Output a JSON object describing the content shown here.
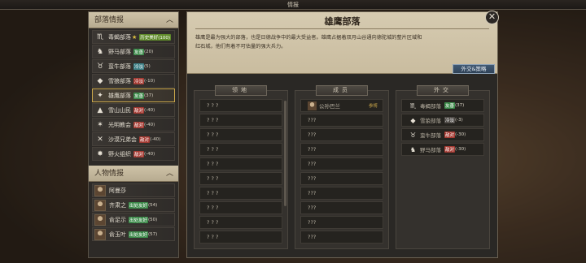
{
  "topbar": {
    "title": "情报"
  },
  "tribes_section": {
    "title": "部落情报",
    "items": [
      {
        "name": "毒蝎部落",
        "star": "★",
        "rel_label": "历史美好(100)",
        "rel_color": "olive",
        "value": "",
        "icon": "scorpion-icon"
      },
      {
        "name": "野马部落",
        "star": "",
        "rel_label": "友善",
        "rel_color": "green",
        "value": "(20)",
        "icon": "horse-icon"
      },
      {
        "name": "蛮牛部落",
        "star": "",
        "rel_label": "冷淡",
        "rel_color": "teal",
        "value": "(5)",
        "icon": "bull-icon"
      },
      {
        "name": "雪狼部落",
        "star": "",
        "rel_label": "冷淡",
        "rel_color": "red",
        "value": "(-10)",
        "icon": "wolf-icon"
      },
      {
        "name": "雄鹰部落",
        "star": "",
        "rel_label": "友善",
        "rel_color": "green",
        "value": "(37)",
        "icon": "eagle-icon"
      },
      {
        "name": "雪山山民",
        "star": "",
        "rel_label": "敌对",
        "rel_color": "red",
        "value": "(-40)",
        "icon": "mountain-icon"
      },
      {
        "name": "光明教会",
        "star": "",
        "rel_label": "敌对",
        "rel_color": "red",
        "value": "(-40)",
        "icon": "church-icon"
      },
      {
        "name": "沙漠兄弟会",
        "star": "",
        "rel_label": "敌对",
        "rel_color": "red",
        "value": "(-40)",
        "icon": "blades-icon"
      },
      {
        "name": "野火组织",
        "star": "",
        "rel_label": "敌对",
        "rel_color": "red",
        "value": "(-40)",
        "icon": "fire-icon"
      }
    ]
  },
  "people_section": {
    "title": "人物情报",
    "items": [
      {
        "name": "阿曼莎",
        "rel_label": "",
        "rel_color": "",
        "value": ""
      },
      {
        "name": "齐肃之",
        "rel_label": "出处友好",
        "rel_color": "green",
        "value": "(54)"
      },
      {
        "name": "俞足示",
        "rel_label": "出处友好",
        "rel_color": "green",
        "value": "(50)"
      },
      {
        "name": "俞玉叶",
        "rel_label": "出处友好",
        "rel_color": "green",
        "value": "(57)"
      }
    ]
  },
  "main": {
    "title": "雄鹰部落",
    "desc_line1": "雄鹰是最为强大的部落，也是日德战争中的最大受益者。雄鹰占据着双月山谷通向德驼城的整片区域和",
    "desc_line2": "红石城，他们有着不可估量的强大兵力。",
    "diplo_button": "外交&策略",
    "close": "✕"
  },
  "columns": {
    "territory": {
      "title": "领地",
      "rows": [
        "? ? ?",
        "? ? ?",
        "? ? ?",
        "? ? ?",
        "? ? ?",
        "? ? ?",
        "? ? ?",
        "? ? ?",
        "? ? ?",
        "? ? ?"
      ]
    },
    "members": {
      "title": "成员",
      "first": {
        "name": "公孙巴兰",
        "role": "参将"
      },
      "rows": [
        "???",
        "???",
        "???",
        "???",
        "???",
        "???",
        "???",
        "???",
        "???"
      ]
    },
    "diplomacy": {
      "title": "外交",
      "rows": [
        {
          "name": "毒蝎部落",
          "rel_label": "友善",
          "rel_color": "green",
          "value": "(37)",
          "icon": "scorpion-icon"
        },
        {
          "name": "雪狼部落",
          "rel_label": "冷淡",
          "rel_color": "gray",
          "value": "(-3)",
          "icon": "wolf-icon"
        },
        {
          "name": "蛮牛部落",
          "rel_label": "敌对",
          "rel_color": "red",
          "value": "(-30)",
          "icon": "bull-icon"
        },
        {
          "name": "野马部落",
          "rel_label": "敌对",
          "rel_color": "red",
          "value": "(-30)",
          "icon": "horse-icon"
        }
      ]
    }
  }
}
